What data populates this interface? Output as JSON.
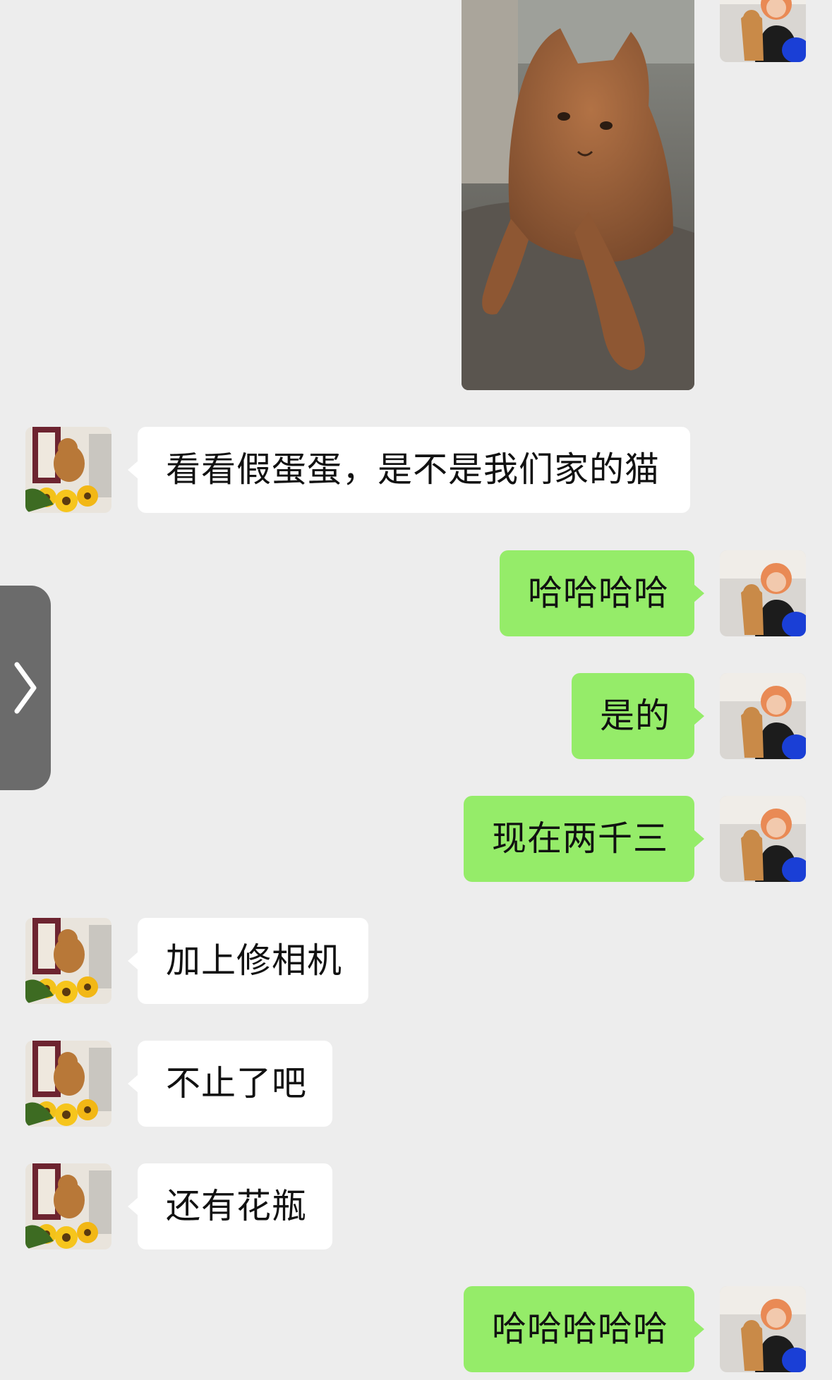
{
  "chat": {
    "photo": {
      "subject": "orange tabby cat lying on a bed"
    },
    "messages": [
      {
        "sender": "contact",
        "text": "看看假蛋蛋，是不是我们家的猫"
      },
      {
        "sender": "me",
        "text": "哈哈哈哈"
      },
      {
        "sender": "me",
        "text": "是的"
      },
      {
        "sender": "me",
        "text": "现在两千三"
      },
      {
        "sender": "contact",
        "text": "加上修相机"
      },
      {
        "sender": "contact",
        "text": "不止了吧"
      },
      {
        "sender": "contact",
        "text": "还有花瓶"
      },
      {
        "sender": "me",
        "text": "哈哈哈哈哈"
      }
    ]
  },
  "colors": {
    "background": "#ededed",
    "incoming_bubble": "#ffffff",
    "outgoing_bubble": "#95ec69",
    "side_tab": "#6b6b6b"
  },
  "icons": {
    "side_tab": "chevron-right-icon"
  }
}
